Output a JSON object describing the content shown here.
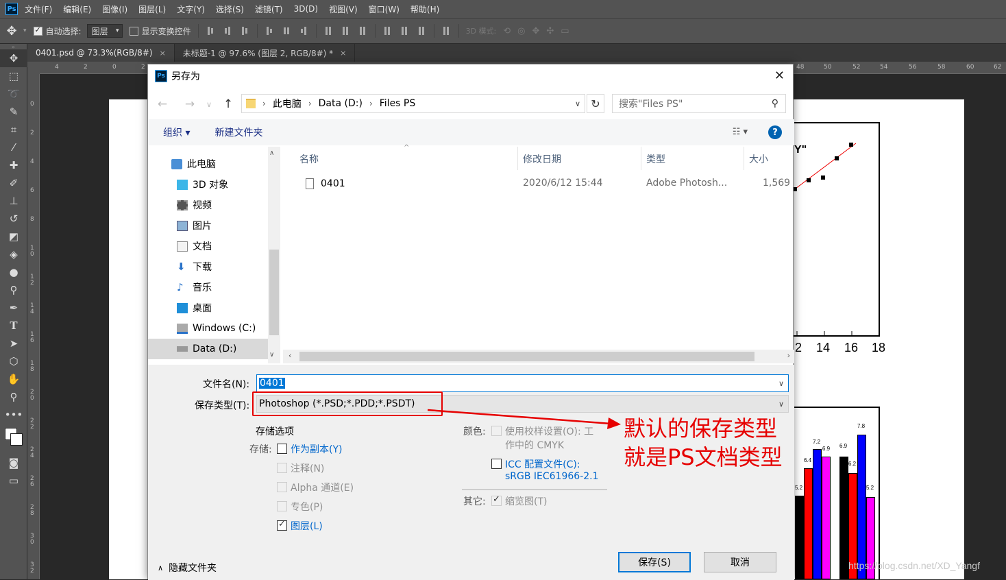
{
  "app": {
    "menu": [
      "文件(F)",
      "编辑(E)",
      "图像(I)",
      "图层(L)",
      "文字(Y)",
      "选择(S)",
      "滤镜(T)",
      "3D(D)",
      "视图(V)",
      "窗口(W)",
      "帮助(H)"
    ],
    "options": {
      "auto_select": "自动选择:",
      "layer_select": "图层",
      "show_transform": "显示变换控件",
      "mode_3d": "3D 模式:"
    },
    "tabs": [
      {
        "label": "0401.psd @ 73.3%(RGB/8#)",
        "close": "×"
      },
      {
        "label": "未标题-1 @ 97.6% (图层 2, RGB/8#) *",
        "close": "×"
      }
    ],
    "ruler_h_labels": [
      "4",
      "2",
      "0",
      "2",
      "48",
      "50",
      "52",
      "54",
      "56",
      "58",
      "60",
      "62"
    ],
    "ruler_v_labels": [
      "0",
      "2",
      "4",
      "6",
      "8",
      "10",
      "12",
      "14",
      "16",
      "18",
      "20",
      "22",
      "24",
      "26",
      "28",
      "30",
      "32"
    ]
  },
  "canvas": {
    "plot1_partial_title": "Y\"",
    "plot1_xticks": [
      "2",
      "14",
      "16",
      "18"
    ],
    "plot2_values": [
      "5.2",
      "6.4",
      "7.2",
      "6.9",
      "6.9",
      "6.2",
      "7.8",
      "5.2"
    ],
    "watermark": "https://blog.csdn.net/XD_Yangf"
  },
  "dialog": {
    "title": "另存为",
    "close": "✕",
    "breadcrumb": [
      "此电脑",
      "Data (D:)",
      "Files PS"
    ],
    "search_placeholder": "搜索\"Files PS\"",
    "organize": "组织 ▾",
    "new_folder": "新建文件夹",
    "help": "?",
    "nav_items": [
      {
        "label": "此电脑",
        "icon": "computer-icon"
      },
      {
        "label": "3D 对象",
        "icon": "cube-icon"
      },
      {
        "label": "视频",
        "icon": "video-icon"
      },
      {
        "label": "图片",
        "icon": "picture-icon"
      },
      {
        "label": "文档",
        "icon": "document-icon"
      },
      {
        "label": "下载",
        "icon": "download-icon"
      },
      {
        "label": "音乐",
        "icon": "music-icon"
      },
      {
        "label": "桌面",
        "icon": "desktop-icon"
      },
      {
        "label": "Windows (C:)",
        "icon": "drive-c-icon"
      },
      {
        "label": "Data (D:)",
        "icon": "drive-d-icon"
      }
    ],
    "columns": {
      "name": "名称",
      "date": "修改日期",
      "type": "类型",
      "size": "大小"
    },
    "files": [
      {
        "name": "0401",
        "date": "2020/6/12 15:44",
        "type": "Adobe Photosh...",
        "size": "1,569"
      }
    ],
    "file_name_label": "文件名(N):",
    "file_name_value": "0401",
    "save_type_label": "保存类型(T):",
    "save_type_value": "Photoshop (*.PSD;*.PDD;*.PSDT)",
    "storage_options": "存储选项",
    "storage": "存储:",
    "as_copy": "作为副本(Y)",
    "notes": "注释(N)",
    "alpha": "Alpha 通道(E)",
    "spot": "专色(P)",
    "layers": "图层(L)",
    "color": "颜色:",
    "proof_line1": "使用校样设置(O): 工",
    "proof_line2": "作中的 CMYK",
    "icc_line1": "ICC 配置文件(C):",
    "icc_line2": "sRGB IEC61966-2.1",
    "other": "其它:",
    "thumbnail": "缩览图(T)",
    "hide_folders": "隐藏文件夹",
    "save": "保存(S)",
    "cancel": "取消"
  },
  "annotation": {
    "line1": "默认的保存类型",
    "line2": "就是PS文档类型",
    "color": "#e60000"
  }
}
